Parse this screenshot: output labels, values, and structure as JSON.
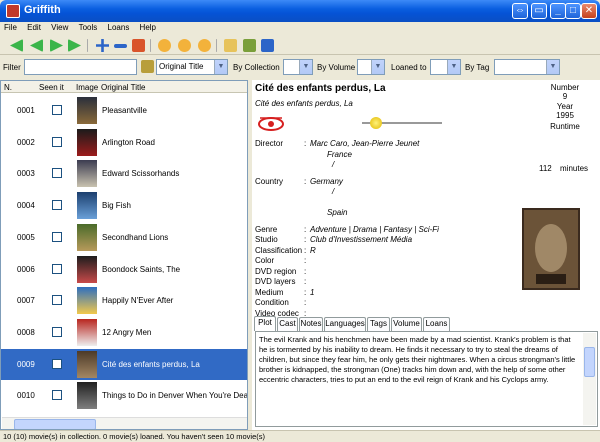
{
  "app": {
    "title": "Griffith"
  },
  "menu": [
    "File",
    "Edit",
    "View",
    "Tools",
    "Loans",
    "Help"
  ],
  "filter": {
    "label": "Filter",
    "search_value": "",
    "field_select": "Original Title",
    "by_collection_label": "By Collection",
    "by_volume_label": "By Volume",
    "loaned_to_label": "Loaned to",
    "by_tag_label": "By Tag"
  },
  "list": {
    "headers": {
      "num": "N.",
      "seen": "Seen it",
      "image": "Image",
      "title": "Original Title"
    },
    "rows": [
      {
        "num": "0001",
        "title": "Pleasantville",
        "selected": false
      },
      {
        "num": "0002",
        "title": "Arlington Road",
        "selected": false
      },
      {
        "num": "0003",
        "title": "Edward Scissorhands",
        "selected": false
      },
      {
        "num": "0004",
        "title": "Big Fish",
        "selected": false
      },
      {
        "num": "0005",
        "title": "Secondhand Lions",
        "selected": false
      },
      {
        "num": "0006",
        "title": "Boondock Saints, The",
        "selected": false
      },
      {
        "num": "0007",
        "title": "Happily N'Ever After",
        "selected": false
      },
      {
        "num": "0008",
        "title": "12 Angry Men",
        "selected": false
      },
      {
        "num": "0009",
        "title": "Cité des enfants perdus, La",
        "selected": true
      },
      {
        "num": "0010",
        "title": "Things to Do in Denver When You're Dead",
        "selected": false
      }
    ]
  },
  "details": {
    "title": "Cité des enfants perdus, La",
    "original_title": "Cité des enfants perdus, La",
    "number_label": "Number",
    "number": "9",
    "year_label": "Year",
    "year": "1995",
    "runtime_label": "Runtime",
    "runtime": "112",
    "minutes": "minutes",
    "fields": [
      {
        "label": "Director",
        "lines": [
          "Marc Caro, Jean-Pierre Jeunet",
          "France",
          "/"
        ]
      },
      {
        "label": "Country",
        "lines": [
          "Germany",
          "/",
          "",
          "Spain"
        ]
      },
      {
        "label": "Genre",
        "lines": [
          "Adventure | Drama | Fantasy | Sci-Fi"
        ]
      },
      {
        "label": "Studio",
        "lines": [
          "Club d'Investissement Média"
        ]
      },
      {
        "label": "Classification",
        "lines": [
          "R"
        ]
      },
      {
        "label": "Color",
        "lines": [
          ""
        ]
      },
      {
        "label": "DVD region",
        "lines": [
          ""
        ]
      },
      {
        "label": "DVD layers",
        "lines": [
          ""
        ]
      },
      {
        "label": "Medium",
        "lines": [
          "1"
        ]
      },
      {
        "label": "Condition",
        "lines": [
          ""
        ]
      },
      {
        "label": "Video codec",
        "lines": [
          ""
        ]
      }
    ],
    "tabs": [
      "Plot",
      "Cast",
      "Notes",
      "Languages",
      "Tags",
      "Volume",
      "Loans"
    ],
    "plot": "The evil Krank and his henchmen have been made by a mad scientist. Krank's problem is that he is tormented by his inability to dream. He finds it necessary to try to steal the dreams of children, but since they fear him, he only gets their nightmares. When a circus strongman's little brother is kidnapped, the strongman (One) tracks him down and, with the help of some other eccentric characters, tries to put an end to the evil reign of Krank and his Cyclops army."
  },
  "status": "10 (10) movie(s) in collection. 0 movie(s) loaned. You haven't seen 10 movie(s)",
  "colors": {
    "selection": "#316ac5",
    "titlebar": "#0553d6"
  }
}
